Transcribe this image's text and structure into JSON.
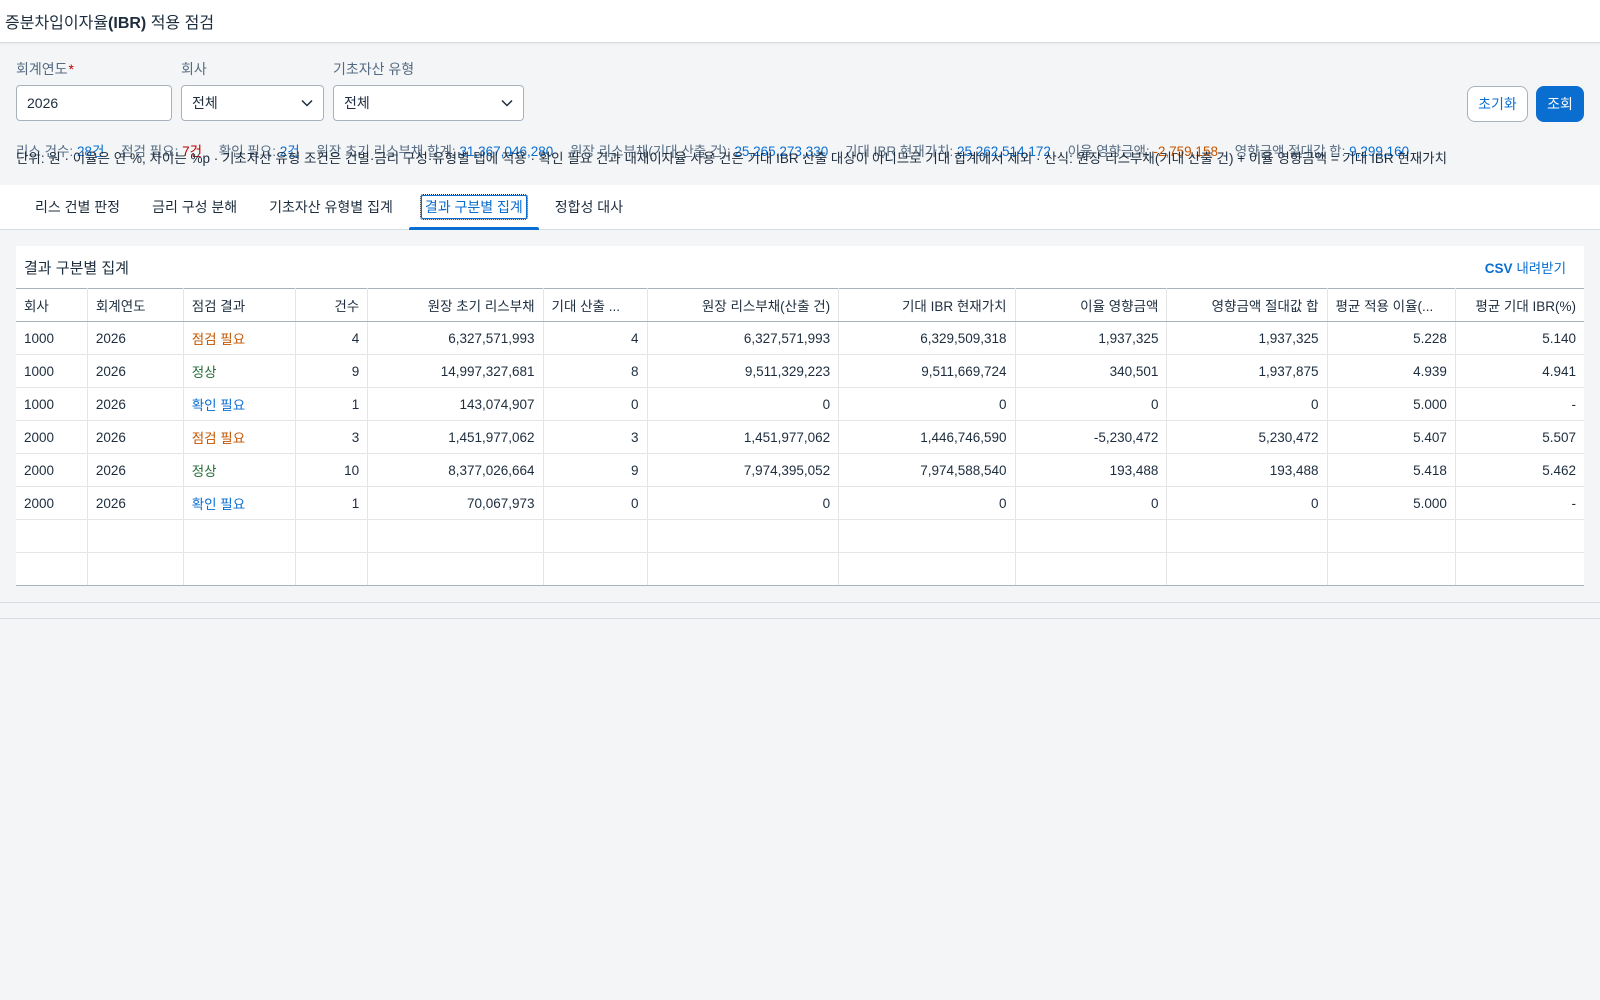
{
  "app": {
    "title_prefix": "증분차입이자율",
    "title_bold": "(IBR)",
    "title_suffix": " 적용 점검"
  },
  "filters": {
    "year": {
      "label": "회계연도",
      "required_mark": "*",
      "value": "2026"
    },
    "company": {
      "label": "회사",
      "value": "전체"
    },
    "asset_type": {
      "label": "기초자산 유형",
      "value": "전체"
    }
  },
  "buttons": {
    "reset": "초기화",
    "search": "조회"
  },
  "stats": {
    "lease_count_label": "리스 건수: ",
    "lease_count_value": "28건",
    "check_needed_label": "점검 필요: ",
    "check_needed_value": "7건",
    "confirm_needed_label": "확인 필요: ",
    "confirm_needed_value": "2건",
    "ledger_total_label": "원장 초기 리스부채 합계: ",
    "ledger_total_value": "31,367,046,280",
    "ledger_expected_label": "원장 리스부채(기대 산출 건): ",
    "ledger_expected_value": "25,265,273,330",
    "expected_pv_label": "기대 IBR 현재가치: ",
    "expected_pv_value": "25,262,514,172",
    "rate_impact_label": "이율 영향금액: ",
    "rate_impact_value": "-2,759,158",
    "abs_impact_label": "영향금액 절대값 합: ",
    "abs_impact_value": "9,299,160"
  },
  "note": "단위: 원 · 이율은 연 %, 차이는 %p · 기초자산 유형 조건은 건별·금리 구성·유형별 탭에 적용 · 확인 필요 건과 내재이자율 사용 건은 기대 IBR 산출 대상이 아니므로 기대 합계에서 제외 · 산식: 원장 리스부채(기대 산출 건) + 이율 영향금액 = 기대 IBR 현재가치",
  "tabs": [
    {
      "label": "리스 건별 판정"
    },
    {
      "label": "금리 구성 분해"
    },
    {
      "label": "기초자산 유형별 집계"
    },
    {
      "label": "결과 구분별 집계"
    },
    {
      "label": "정합성 대사"
    }
  ],
  "panel": {
    "title": "결과 구분별 집계",
    "csv_bold": "CSV",
    "csv_rest": " 내려받기"
  },
  "table": {
    "headers": [
      "회사",
      "회계연도",
      "점검 결과",
      "건수",
      "원장 초기 리스부채",
      "기대 산출 ...",
      "원장 리스부채(산출 건)",
      "기대 IBR 현재가치",
      "이율 영향금액",
      "영향금액 절대값 합",
      "평균 적용 이율(...",
      "평균 기대 IBR(%)"
    ],
    "rows": [
      [
        "1000",
        "2026",
        "점검 필요",
        "4",
        "6,327,571,993",
        "4",
        "6,327,571,993",
        "6,329,509,318",
        "1,937,325",
        "1,937,325",
        "5.228",
        "5.140"
      ],
      [
        "1000",
        "2026",
        "정상",
        "9",
        "14,997,327,681",
        "8",
        "9,511,329,223",
        "9,511,669,724",
        "340,501",
        "1,937,875",
        "4.939",
        "4.941"
      ],
      [
        "1000",
        "2026",
        "확인 필요",
        "1",
        "143,074,907",
        "0",
        "0",
        "0",
        "0",
        "0",
        "5.000",
        "-"
      ],
      [
        "2000",
        "2026",
        "점검 필요",
        "3",
        "1,451,977,062",
        "3",
        "1,451,977,062",
        "1,446,746,590",
        "-5,230,472",
        "5,230,472",
        "5.407",
        "5.507"
      ],
      [
        "2000",
        "2026",
        "정상",
        "10",
        "8,377,026,664",
        "9",
        "7,974,395,052",
        "7,974,588,540",
        "193,488",
        "193,488",
        "5.418",
        "5.462"
      ],
      [
        "2000",
        "2026",
        "확인 필요",
        "1",
        "70,067,973",
        "0",
        "0",
        "0",
        "0",
        "0",
        "5.000",
        "-"
      ]
    ]
  },
  "colors": {
    "accent": "#0a6ed1",
    "warn": "#c35500",
    "ok": "#256f3a",
    "required": "#bb0000"
  }
}
